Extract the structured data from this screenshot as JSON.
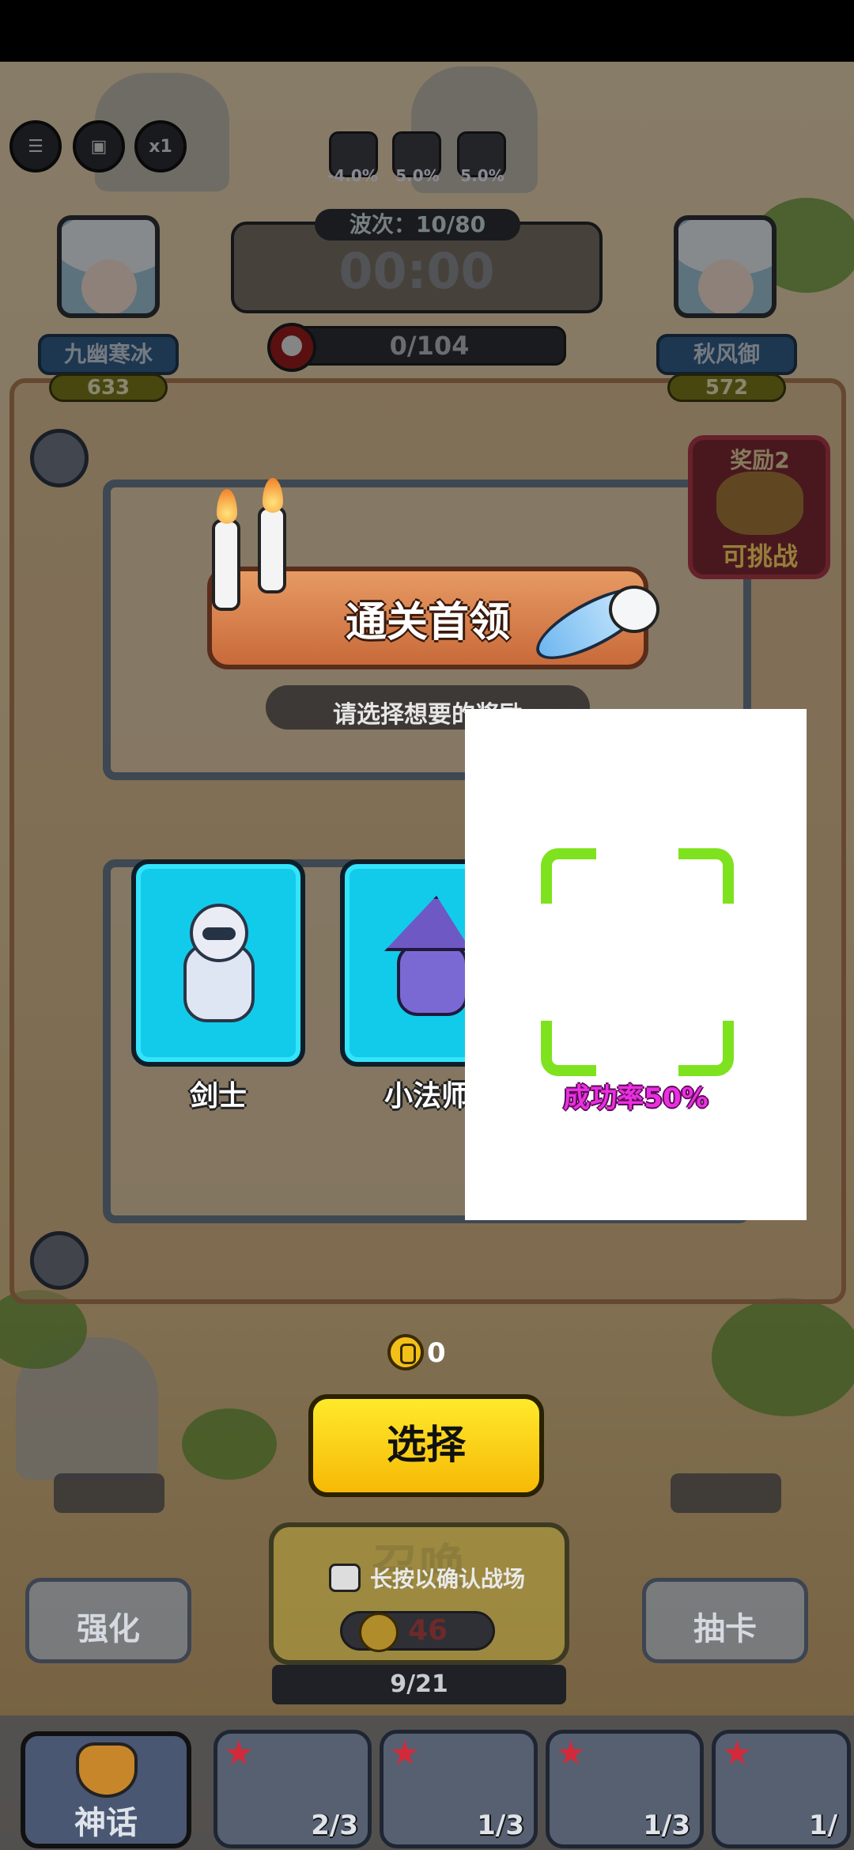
{
  "top_bar": {
    "menu_icon": "hamburger-menu-icon",
    "replay_icon": "replay-screen-icon",
    "speed_label": "x1",
    "stats": [
      "-4.0%",
      "5.0%",
      "5.0%"
    ]
  },
  "wave": {
    "label": "波次：10/80",
    "timer": "00:00",
    "kills": "0/104"
  },
  "player_left": {
    "name": "九幽寒冰",
    "score": "633"
  },
  "player_right": {
    "name": "秋风御",
    "score": "572"
  },
  "reward_card": {
    "title": "奖励2",
    "status": "可挑战"
  },
  "dialog": {
    "title": "通关首领",
    "subtitle": "请选择想要的奖励",
    "choices": [
      {
        "label": "剑士"
      },
      {
        "label": "小法师"
      }
    ],
    "overlay_rate": "成功率50%"
  },
  "currency": {
    "count": "0"
  },
  "select_button": "选择",
  "bottom": {
    "enhance_label": "强化",
    "draw_label": "抽卡",
    "summon_title": "召唤",
    "hint": "长按以确认战场",
    "summon_cost": "46",
    "population": "9/21",
    "myth_label": "神话",
    "slots": [
      "2/3",
      "1/3",
      "1/3",
      "1/"
    ]
  },
  "colors": {
    "choice_card": "#12cbea",
    "select_button": "#ffd21a",
    "rate_text": "#ea2fe0",
    "corner_bracket": "#7ee21e"
  }
}
